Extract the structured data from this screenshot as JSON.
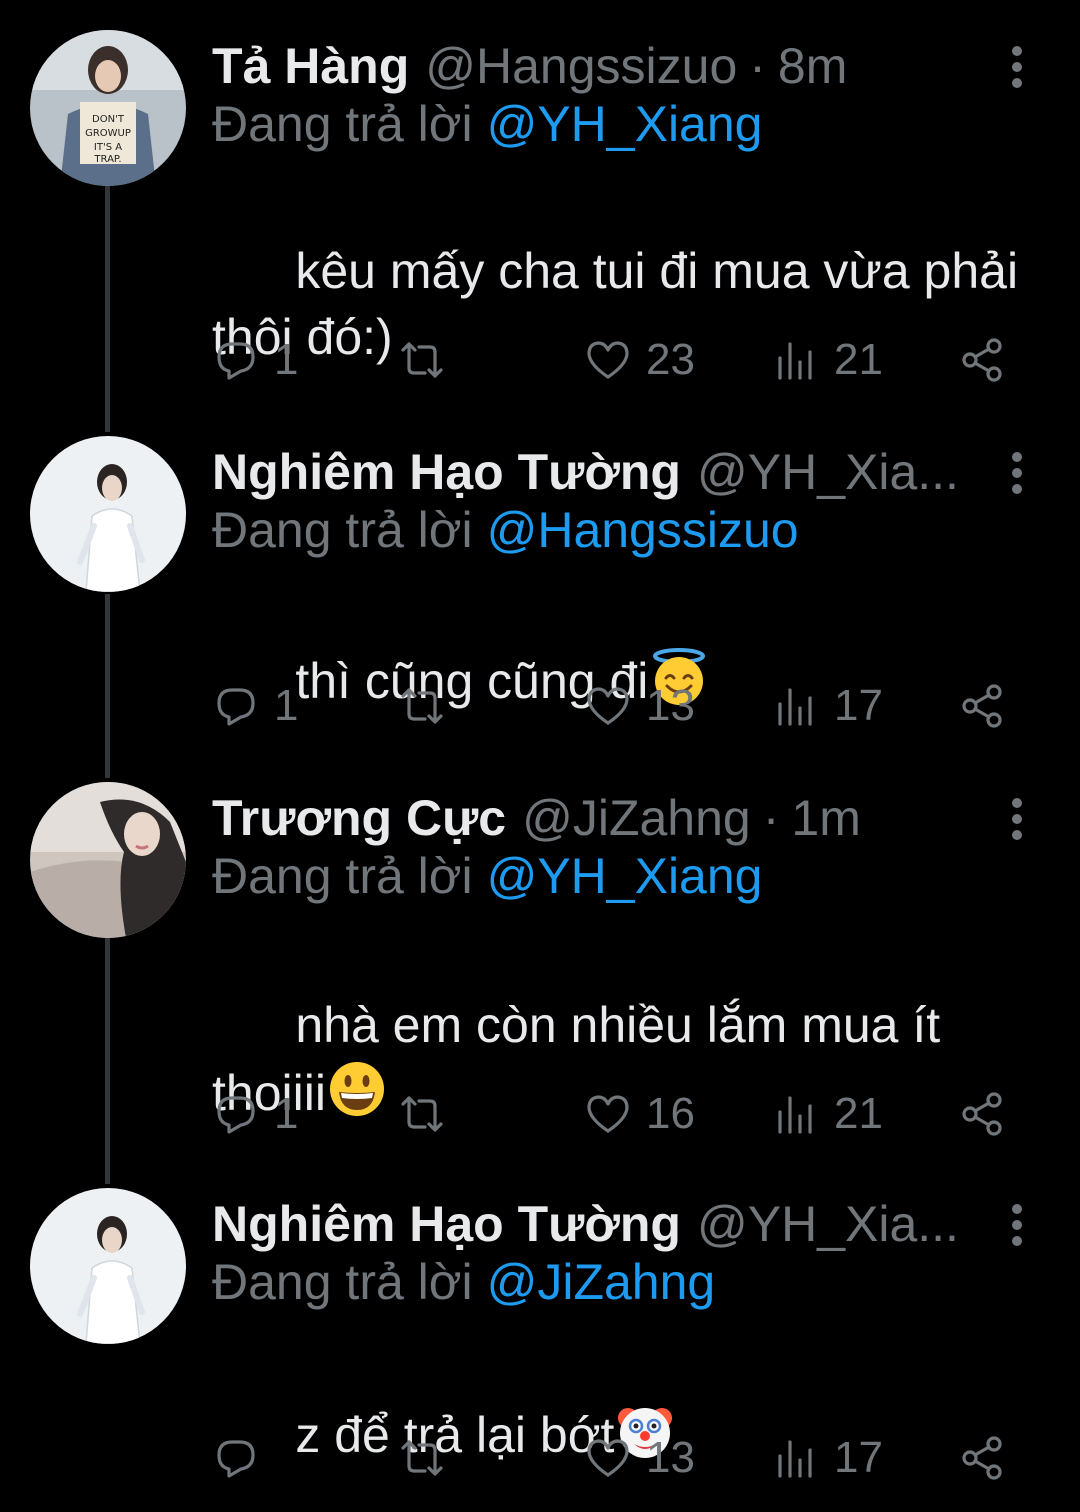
{
  "colors": {
    "background": "#000000",
    "primary_text": "#e7e9ea",
    "secondary_text": "#71767b",
    "mention": "#1d9bf0",
    "thread_line": "#333639"
  },
  "replying_prefix": "Đang trả lời",
  "tweets": [
    {
      "display_name": "Tả Hàng",
      "handle": "@Hangssizuo",
      "separator": "·",
      "time": "8m",
      "reply_to": "@YH_Xiang",
      "text": "kêu mấy cha tui đi mua vừa phải\nthôi đó:)",
      "emoji": "",
      "stats": {
        "replies": "1",
        "retweets": "",
        "likes": "23",
        "views": "21"
      }
    },
    {
      "display_name": "Nghiêm Hạo Tường",
      "handle": "@YH_Xia...",
      "separator": "",
      "time": "",
      "reply_to": "@Hangssizuo",
      "text": "thì cũng cũng đi",
      "emoji": "smiling-face-with-halo",
      "stats": {
        "replies": "1",
        "retweets": "",
        "likes": "13",
        "views": "17"
      }
    },
    {
      "display_name": "Trương Cực",
      "handle": "@JiZahng",
      "separator": "·",
      "time": "1m",
      "reply_to": "@YH_Xiang",
      "text": "nhà em còn nhiều lắm mua ít\nthoiiii",
      "emoji": "grinning-face",
      "stats": {
        "replies": "1",
        "retweets": "",
        "likes": "16",
        "views": "21"
      }
    },
    {
      "display_name": "Nghiêm Hạo Tường",
      "handle": "@YH_Xia...",
      "separator": "",
      "time": "",
      "reply_to": "@JiZahng",
      "text": "z để trả lại bớt",
      "emoji": "clown-face",
      "stats": {
        "replies": "",
        "retweets": "",
        "likes": "13",
        "views": "17"
      }
    }
  ],
  "icons": {
    "reply": "reply-bubble-icon",
    "retweet": "retweet-icon",
    "like": "heart-icon",
    "views": "views-bar-icon",
    "share": "share-icon",
    "more": "more-vertical-icon"
  }
}
